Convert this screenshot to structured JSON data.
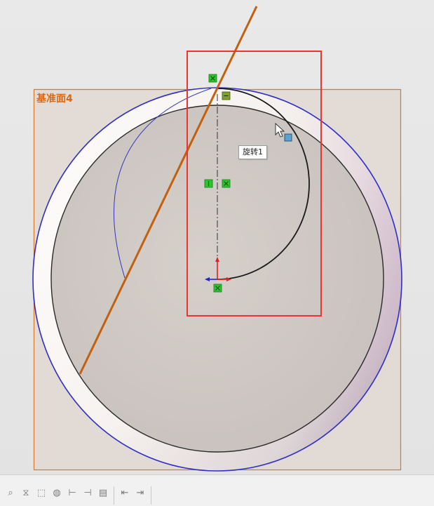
{
  "viewport": {
    "plane_label": "基准面4",
    "tooltip": "旋转1",
    "colors": {
      "plane_border": "#d87a2e",
      "plane_fill": "#e0d7d0",
      "outer_circle": "#2d2dc8",
      "construction_line": "#c2600e",
      "selection_box": "#ee3333",
      "sketch_arc": "#1a1a1a",
      "relation_marker": "#2fc42f",
      "origin_x": "#2222cc",
      "origin_y": "#dd2222"
    }
  },
  "toolbar": {
    "buttons": [
      {
        "name": "zoom-icon",
        "glyph": "⌕"
      },
      {
        "name": "section-icon",
        "glyph": "⧖"
      },
      {
        "name": "view-orientation-icon",
        "glyph": "⬚"
      },
      {
        "name": "display-style-icon",
        "glyph": "◍"
      },
      {
        "name": "align-icon-1",
        "glyph": "⊢"
      },
      {
        "name": "align-icon-2",
        "glyph": "⊣"
      },
      {
        "name": "display-icon",
        "glyph": "▤"
      },
      {
        "name": "pin-icon-1",
        "glyph": "⇤"
      },
      {
        "name": "pin-icon-2",
        "glyph": "⇥"
      }
    ]
  }
}
